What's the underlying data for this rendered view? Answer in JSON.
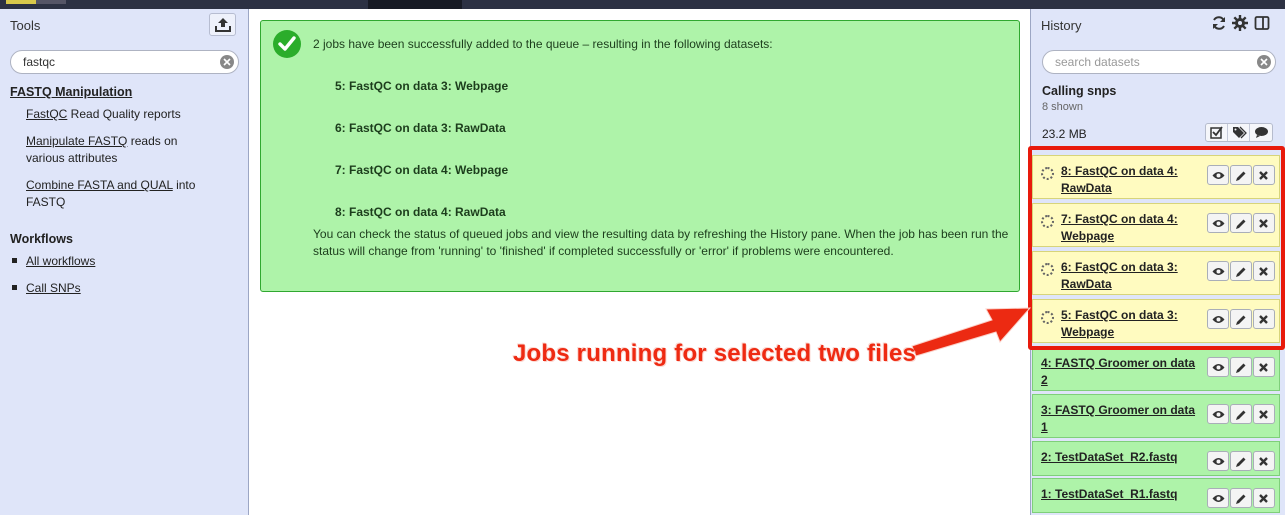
{
  "tools_panel": {
    "title": "Tools",
    "search_value": "fastqc",
    "section_title": "FASTQ Manipulation",
    "tools": [
      {
        "link": "FastQC",
        "rest": " Read Quality reports"
      },
      {
        "link": "Manipulate FASTQ",
        "rest": " reads on various attributes"
      },
      {
        "link": "Combine FASTA and QUAL",
        "rest": " into FASTQ"
      }
    ],
    "workflows_title": "Workflows",
    "workflows": [
      "All workflows",
      "Call SNPs"
    ]
  },
  "message": {
    "lead": "2 jobs have been successfully added to the queue – resulting in the following datasets:",
    "datasets": [
      "5: FastQC on data 3: Webpage",
      "6: FastQC on data 3: RawData",
      "7: FastQC on data 4: Webpage",
      "8: FastQC on data 4: RawData"
    ],
    "note": "You can check the status of queued jobs and view the resulting data by refreshing the History pane. When the job has been run the status will change from 'running' to 'finished' if completed successfully or 'error' if problems were encountered."
  },
  "history": {
    "title": "History",
    "search_placeholder": "search datasets",
    "name": "Calling snps",
    "shown": "8 shown",
    "size": "23.2 MB",
    "datasets": [
      {
        "title": "8: FastQC on data 4: RawData",
        "state": "queued"
      },
      {
        "title": "7: FastQC on data 4: Webpage",
        "state": "queued"
      },
      {
        "title": "6: FastQC on data 3: RawData",
        "state": "queued"
      },
      {
        "title": "5: FastQC on data 3: Webpage",
        "state": "queued"
      },
      {
        "title": "4: FASTQ Groomer on data 2",
        "state": "ok"
      },
      {
        "title": "3: FASTQ Groomer on data 1",
        "state": "ok"
      },
      {
        "title": "2: TestDataSet_R2.fastq",
        "state": "ok"
      },
      {
        "title": "1: TestDataSet_R1.fastq",
        "state": "ok"
      }
    ]
  },
  "annotation": {
    "text": "Jobs running for selected two files",
    "color": "#ee2a12"
  },
  "colors": {
    "panel_bg": "#dfe5f9",
    "success_bg": "#aef3a9",
    "queued_bg": "#fffbc0",
    "masthead": "#2c3143"
  }
}
